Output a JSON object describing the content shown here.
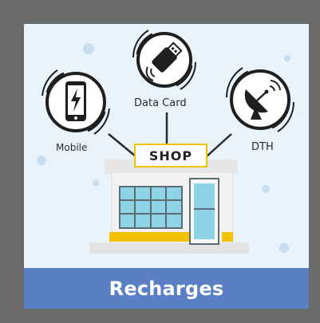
{
  "services": [
    {
      "id": "mobile",
      "label": "Mobile",
      "icon": "mobile-phone-icon"
    },
    {
      "id": "datacard",
      "label": "Data Card",
      "icon": "usb-data-card-icon"
    },
    {
      "id": "dth",
      "label": "DTH",
      "icon": "satellite-dish-icon"
    }
  ],
  "shop": {
    "sign": "SHOP"
  },
  "banner": {
    "title": "Recharges"
  },
  "colors": {
    "frame": "#6b6b6b",
    "panel": "#e8f3fb",
    "banner": "#5b7fc4",
    "accent_yellow": "#f2c200",
    "glass": "#8fd3e6",
    "dark": "#1f1f1f"
  }
}
